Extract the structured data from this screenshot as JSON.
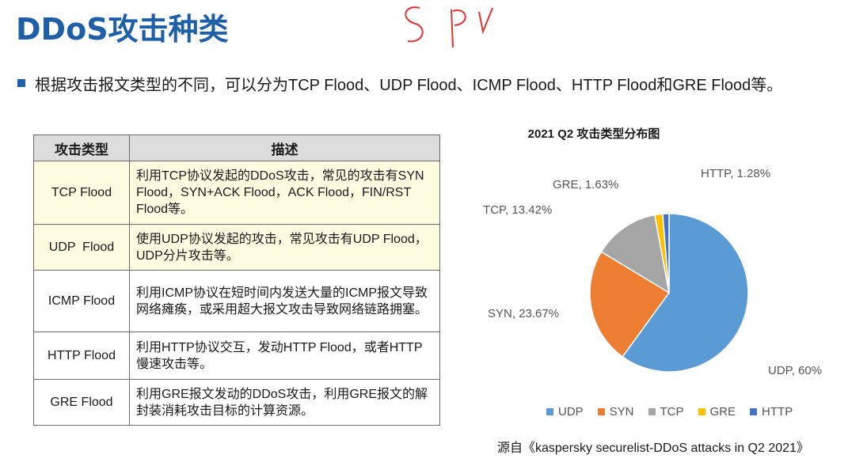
{
  "slide": {
    "title": "DDoS攻击种类",
    "intro": "根据攻击报文类型的不同，可以分为TCP Flood、UDP Flood、ICMP Flood、HTTP Flood和GRE Flood等。"
  },
  "table": {
    "headers": [
      "攻击类型",
      "描述"
    ],
    "rows": [
      {
        "type": "TCP Flood",
        "desc": "利用TCP协议发起的DDoS攻击，常见的攻击有SYN Flood，SYN+ACK Flood，ACK Flood，FIN/RST Flood等。"
      },
      {
        "type": "UDP  Flood",
        "desc": "使用UDP协议发起的攻击，常见攻击有UDP Flood，UDP分片攻击等。"
      },
      {
        "type": "ICMP Flood",
        "desc": "利用ICMP协议在短时间内发送大量的ICMP报文导致网络瘫痪，或采用超大报文攻击导致网络链路拥塞。"
      },
      {
        "type": "HTTP Flood",
        "desc": "利用HTTP协议交互，发动HTTP Flood，或者HTTP慢速攻击等。"
      },
      {
        "type": "GRE Flood",
        "desc": "利用GRE报文发动的DDoS攻击，利用GRE报文的解封装消耗攻击目标的计算资源。"
      }
    ]
  },
  "chart_data": {
    "type": "pie",
    "title": "2021 Q2 攻击类型分布图",
    "slices": [
      {
        "name": "UDP",
        "value": 60,
        "label": "UDP, 60%",
        "color": "#5b9bd5"
      },
      {
        "name": "SYN",
        "value": 23.67,
        "label": "SYN, 23.67%",
        "color": "#ed7d31"
      },
      {
        "name": "TCP",
        "value": 13.42,
        "label": "TCP, 13.42%",
        "color": "#a5a5a5"
      },
      {
        "name": "GRE",
        "value": 1.63,
        "label": "GRE, 1.63%",
        "color": "#ffc000"
      },
      {
        "name": "HTTP",
        "value": 1.28,
        "label": "HTTP, 1.28%",
        "color": "#4472c4"
      }
    ],
    "legend": [
      "UDP",
      "SYN",
      "TCP",
      "GRE",
      "HTTP"
    ],
    "legend_position": "bottom"
  },
  "source": "源自《kaspersky securelist-DDoS attacks in Q2 2021》"
}
